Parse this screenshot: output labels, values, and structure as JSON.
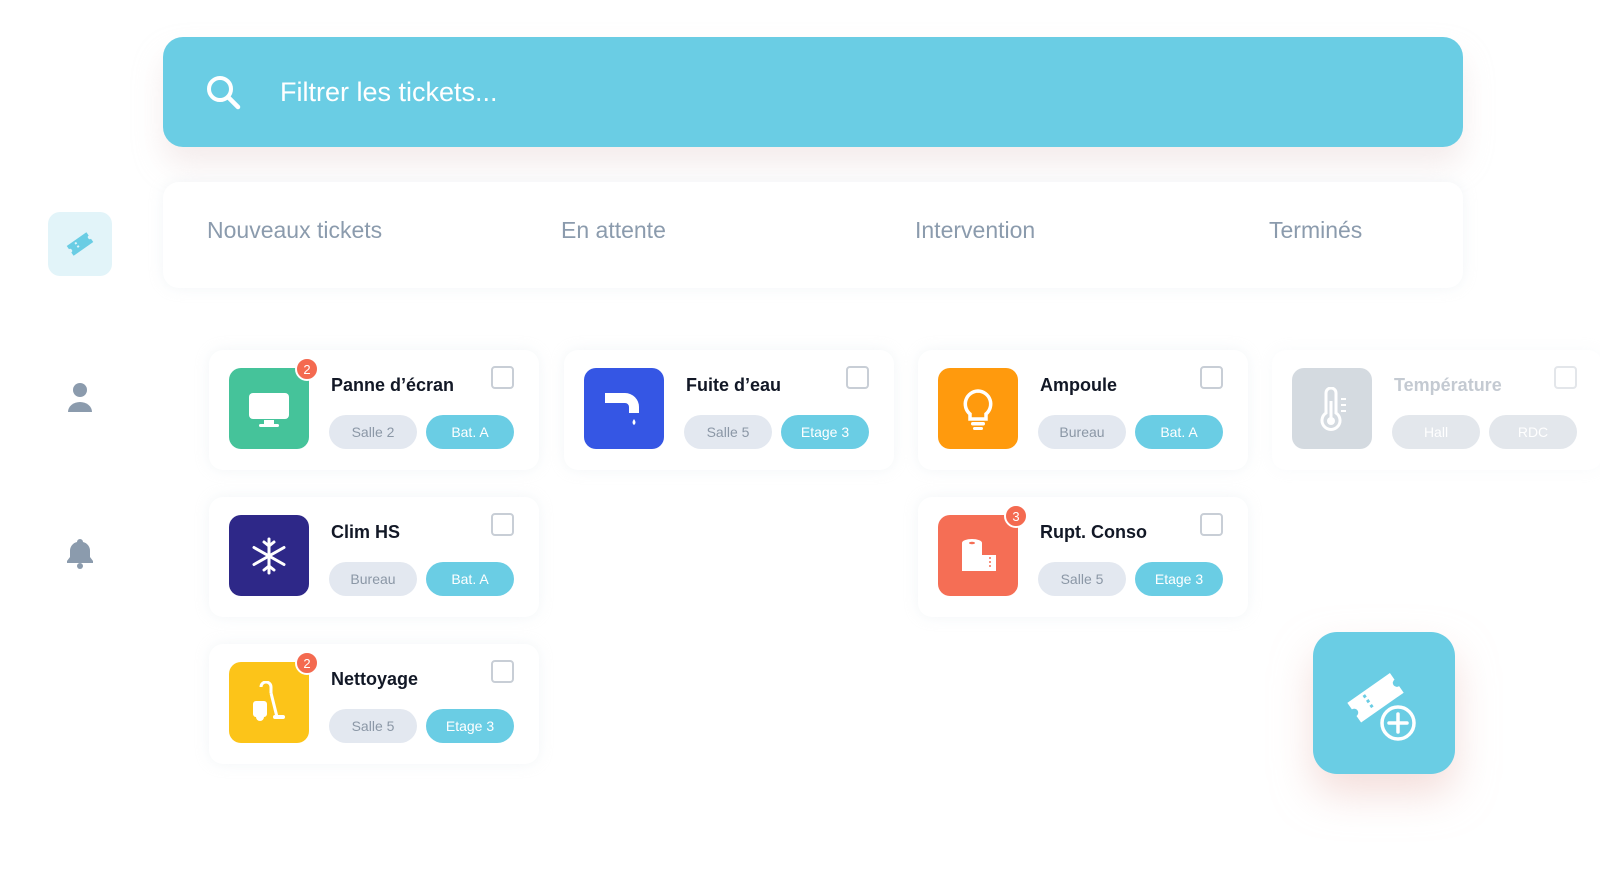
{
  "search": {
    "placeholder": "Filtrer les tickets..."
  },
  "sidebar": {
    "items": [
      {
        "name": "tickets",
        "icon": "ticket-icon",
        "active": true
      },
      {
        "name": "users",
        "icon": "user-icon",
        "active": false
      },
      {
        "name": "notifications",
        "icon": "bell-icon",
        "active": false
      }
    ]
  },
  "tabs": [
    "Nouveaux tickets",
    "En attente",
    "Intervention",
    "Terminés"
  ],
  "cards": [
    {
      "title": "Panne d’écran",
      "location": "Salle 2",
      "building": "Bat. A",
      "badge": "2",
      "icon": "monitor-icon",
      "color": "#45c39a"
    },
    {
      "title": "Clim HS",
      "location": "Bureau",
      "building": "Bat. A",
      "badge": "",
      "icon": "snowflake-icon",
      "color": "#2e2888"
    },
    {
      "title": "Nettoyage",
      "location": "Salle 5",
      "building": "Etage 3",
      "badge": "2",
      "icon": "vacuum-icon",
      "color": "#fcc419"
    },
    {
      "title": "Fuite d’eau",
      "location": "Salle 5",
      "building": "Etage 3",
      "badge": "",
      "icon": "faucet-icon",
      "color": "#3556e4"
    },
    {
      "title": "Ampoule",
      "location": "Bureau",
      "building": "Bat. A",
      "badge": "",
      "icon": "lightbulb-icon",
      "color": "#ff9a0d"
    },
    {
      "title": "Rupt. Conso",
      "location": "Salle 5",
      "building": "Etage 3",
      "badge": "3",
      "icon": "toilet-paper-icon",
      "color": "#f56e55"
    },
    {
      "title": "Température",
      "location": "Hall",
      "building": "RDC",
      "badge": "",
      "icon": "thermometer-icon",
      "color": "#aab6c3"
    }
  ],
  "fab": {
    "icon": "add-ticket-icon"
  },
  "colors": {
    "accent": "#6acde4",
    "badge": "#f46a50",
    "muted": "#8b9bad"
  }
}
